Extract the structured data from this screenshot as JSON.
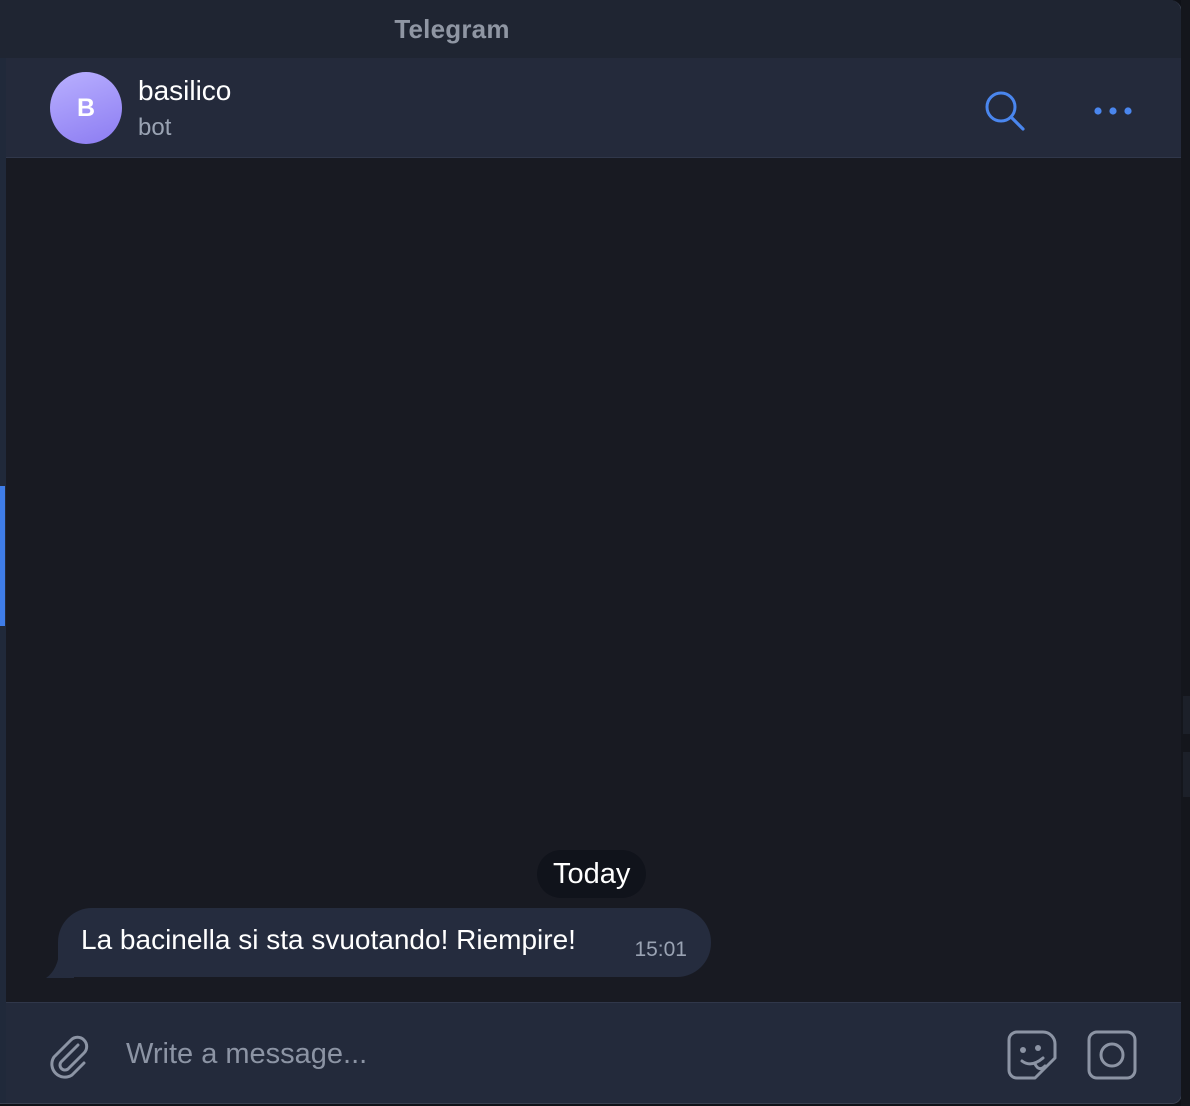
{
  "window": {
    "title": "Telegram"
  },
  "chat": {
    "avatar_initial": "B",
    "name": "basilico",
    "status": "bot",
    "search_icon": "search-icon",
    "more_icon": "more-horizontal-icon"
  },
  "messages": {
    "date_separator": "Today",
    "items": [
      {
        "text": "La bacinella si sta svuotando! Riempire!",
        "time": "15:01",
        "direction": "incoming"
      }
    ]
  },
  "composer": {
    "placeholder": "Write a message...",
    "value": "",
    "attach_icon": "paperclip-icon",
    "sticker_icon": "sticker-icon",
    "video_icon": "video-message-icon"
  },
  "colors": {
    "accent": "#3f7de8",
    "header_bg": "#242a3b",
    "chat_bg": "#181a22",
    "bubble_bg": "#252c3e",
    "avatar_gradient_start": "#b9b0ff",
    "avatar_gradient_end": "#8c7cf2"
  }
}
